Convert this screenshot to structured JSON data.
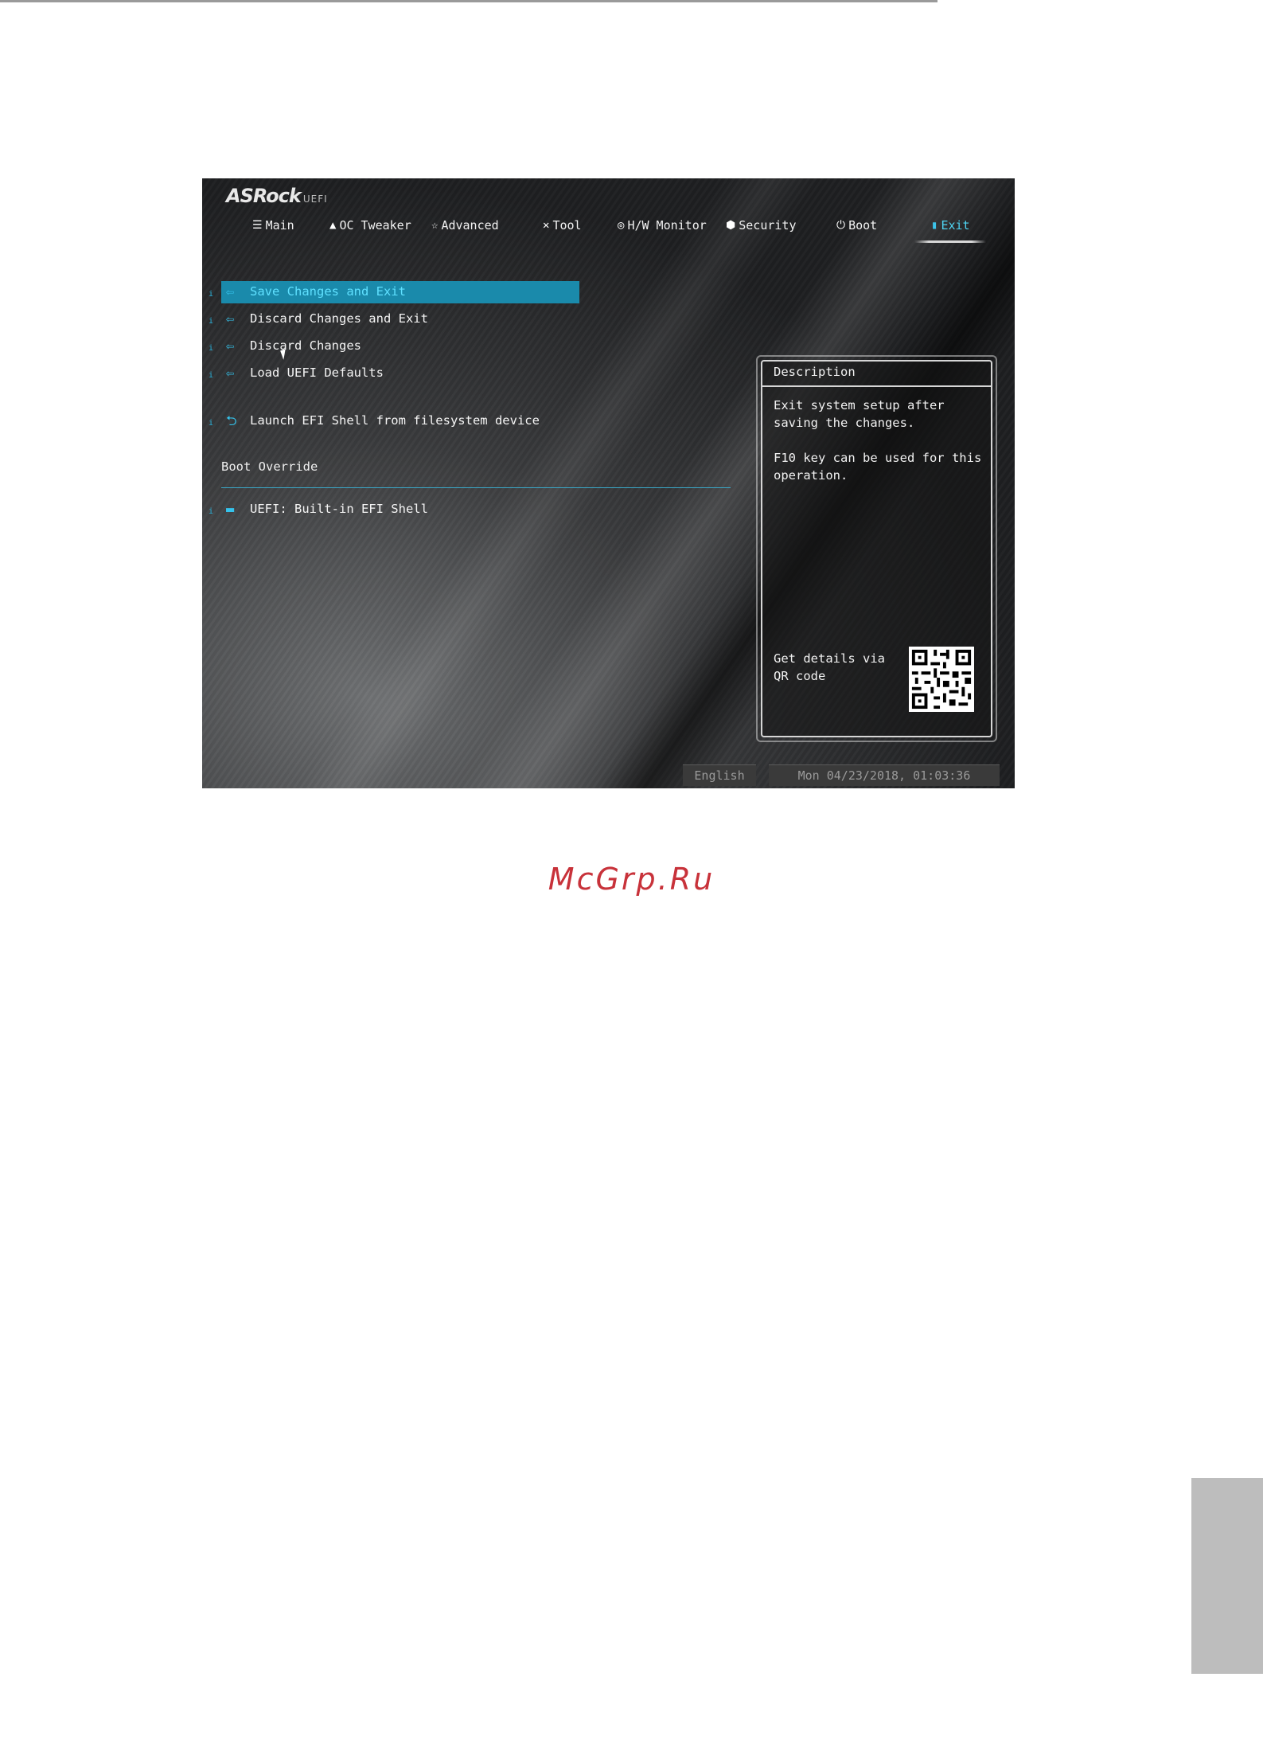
{
  "bios": {
    "brand": "ASRock",
    "brand_suffix": "UEFI",
    "tabs": [
      {
        "label": "Main",
        "icon": "list-icon"
      },
      {
        "label": "OC Tweaker",
        "icon": "rocket-icon"
      },
      {
        "label": "Advanced",
        "icon": "star-icon"
      },
      {
        "label": "Tool",
        "icon": "tools-icon"
      },
      {
        "label": "H/W Monitor",
        "icon": "monitor-icon"
      },
      {
        "label": "Security",
        "icon": "shield-icon"
      },
      {
        "label": "Boot",
        "icon": "power-icon"
      },
      {
        "label": "Exit",
        "icon": "exit-door-icon",
        "active": true
      }
    ],
    "menu": [
      {
        "label": "Save Changes and Exit",
        "selected": true
      },
      {
        "label": "Discard Changes and Exit"
      },
      {
        "label": "Discard Changes"
      },
      {
        "label": "Load UEFI Defaults"
      },
      {
        "label": "Launch EFI Shell from filesystem device"
      }
    ],
    "boot_override": {
      "heading": "Boot Override",
      "items": [
        {
          "label": "UEFI: Built-in EFI Shell"
        }
      ]
    },
    "description": {
      "title": "Description",
      "text": "Exit system setup after saving the changes.\n\nF10 key can be used for this operation.",
      "qr_text": "Get details via QR code"
    },
    "status_bar": {
      "language": "English",
      "datetime": "Mon 04/23/2018, 01:03:36"
    },
    "colors": {
      "accent": "#35c3ec",
      "highlight": "#1a8aab"
    }
  },
  "page": {
    "watermark": "McGrp.Ru"
  }
}
